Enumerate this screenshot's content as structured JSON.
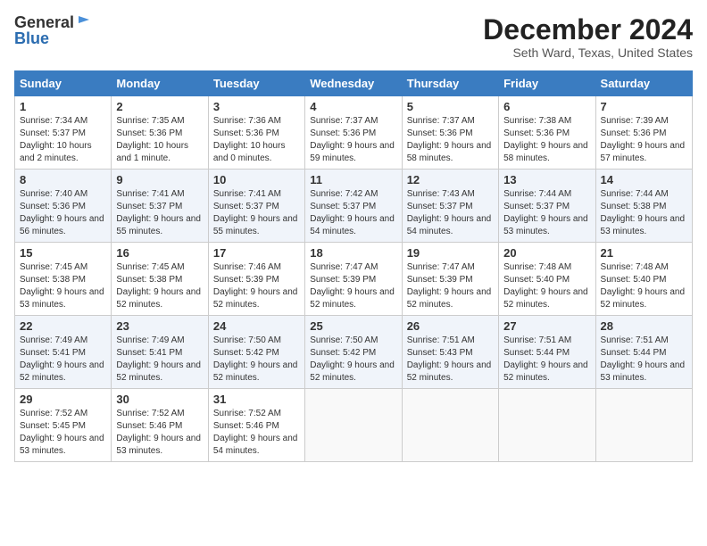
{
  "header": {
    "logo_general": "General",
    "logo_blue": "Blue",
    "month_title": "December 2024",
    "location": "Seth Ward, Texas, United States"
  },
  "days_of_week": [
    "Sunday",
    "Monday",
    "Tuesday",
    "Wednesday",
    "Thursday",
    "Friday",
    "Saturday"
  ],
  "weeks": [
    [
      {
        "day": "1",
        "sunrise": "Sunrise: 7:34 AM",
        "sunset": "Sunset: 5:37 PM",
        "daylight": "Daylight: 10 hours and 2 minutes."
      },
      {
        "day": "2",
        "sunrise": "Sunrise: 7:35 AM",
        "sunset": "Sunset: 5:36 PM",
        "daylight": "Daylight: 10 hours and 1 minute."
      },
      {
        "day": "3",
        "sunrise": "Sunrise: 7:36 AM",
        "sunset": "Sunset: 5:36 PM",
        "daylight": "Daylight: 10 hours and 0 minutes."
      },
      {
        "day": "4",
        "sunrise": "Sunrise: 7:37 AM",
        "sunset": "Sunset: 5:36 PM",
        "daylight": "Daylight: 9 hours and 59 minutes."
      },
      {
        "day": "5",
        "sunrise": "Sunrise: 7:37 AM",
        "sunset": "Sunset: 5:36 PM",
        "daylight": "Daylight: 9 hours and 58 minutes."
      },
      {
        "day": "6",
        "sunrise": "Sunrise: 7:38 AM",
        "sunset": "Sunset: 5:36 PM",
        "daylight": "Daylight: 9 hours and 58 minutes."
      },
      {
        "day": "7",
        "sunrise": "Sunrise: 7:39 AM",
        "sunset": "Sunset: 5:36 PM",
        "daylight": "Daylight: 9 hours and 57 minutes."
      }
    ],
    [
      {
        "day": "8",
        "sunrise": "Sunrise: 7:40 AM",
        "sunset": "Sunset: 5:36 PM",
        "daylight": "Daylight: 9 hours and 56 minutes."
      },
      {
        "day": "9",
        "sunrise": "Sunrise: 7:41 AM",
        "sunset": "Sunset: 5:37 PM",
        "daylight": "Daylight: 9 hours and 55 minutes."
      },
      {
        "day": "10",
        "sunrise": "Sunrise: 7:41 AM",
        "sunset": "Sunset: 5:37 PM",
        "daylight": "Daylight: 9 hours and 55 minutes."
      },
      {
        "day": "11",
        "sunrise": "Sunrise: 7:42 AM",
        "sunset": "Sunset: 5:37 PM",
        "daylight": "Daylight: 9 hours and 54 minutes."
      },
      {
        "day": "12",
        "sunrise": "Sunrise: 7:43 AM",
        "sunset": "Sunset: 5:37 PM",
        "daylight": "Daylight: 9 hours and 54 minutes."
      },
      {
        "day": "13",
        "sunrise": "Sunrise: 7:44 AM",
        "sunset": "Sunset: 5:37 PM",
        "daylight": "Daylight: 9 hours and 53 minutes."
      },
      {
        "day": "14",
        "sunrise": "Sunrise: 7:44 AM",
        "sunset": "Sunset: 5:38 PM",
        "daylight": "Daylight: 9 hours and 53 minutes."
      }
    ],
    [
      {
        "day": "15",
        "sunrise": "Sunrise: 7:45 AM",
        "sunset": "Sunset: 5:38 PM",
        "daylight": "Daylight: 9 hours and 53 minutes."
      },
      {
        "day": "16",
        "sunrise": "Sunrise: 7:45 AM",
        "sunset": "Sunset: 5:38 PM",
        "daylight": "Daylight: 9 hours and 52 minutes."
      },
      {
        "day": "17",
        "sunrise": "Sunrise: 7:46 AM",
        "sunset": "Sunset: 5:39 PM",
        "daylight": "Daylight: 9 hours and 52 minutes."
      },
      {
        "day": "18",
        "sunrise": "Sunrise: 7:47 AM",
        "sunset": "Sunset: 5:39 PM",
        "daylight": "Daylight: 9 hours and 52 minutes."
      },
      {
        "day": "19",
        "sunrise": "Sunrise: 7:47 AM",
        "sunset": "Sunset: 5:39 PM",
        "daylight": "Daylight: 9 hours and 52 minutes."
      },
      {
        "day": "20",
        "sunrise": "Sunrise: 7:48 AM",
        "sunset": "Sunset: 5:40 PM",
        "daylight": "Daylight: 9 hours and 52 minutes."
      },
      {
        "day": "21",
        "sunrise": "Sunrise: 7:48 AM",
        "sunset": "Sunset: 5:40 PM",
        "daylight": "Daylight: 9 hours and 52 minutes."
      }
    ],
    [
      {
        "day": "22",
        "sunrise": "Sunrise: 7:49 AM",
        "sunset": "Sunset: 5:41 PM",
        "daylight": "Daylight: 9 hours and 52 minutes."
      },
      {
        "day": "23",
        "sunrise": "Sunrise: 7:49 AM",
        "sunset": "Sunset: 5:41 PM",
        "daylight": "Daylight: 9 hours and 52 minutes."
      },
      {
        "day": "24",
        "sunrise": "Sunrise: 7:50 AM",
        "sunset": "Sunset: 5:42 PM",
        "daylight": "Daylight: 9 hours and 52 minutes."
      },
      {
        "day": "25",
        "sunrise": "Sunrise: 7:50 AM",
        "sunset": "Sunset: 5:42 PM",
        "daylight": "Daylight: 9 hours and 52 minutes."
      },
      {
        "day": "26",
        "sunrise": "Sunrise: 7:51 AM",
        "sunset": "Sunset: 5:43 PM",
        "daylight": "Daylight: 9 hours and 52 minutes."
      },
      {
        "day": "27",
        "sunrise": "Sunrise: 7:51 AM",
        "sunset": "Sunset: 5:44 PM",
        "daylight": "Daylight: 9 hours and 52 minutes."
      },
      {
        "day": "28",
        "sunrise": "Sunrise: 7:51 AM",
        "sunset": "Sunset: 5:44 PM",
        "daylight": "Daylight: 9 hours and 53 minutes."
      }
    ],
    [
      {
        "day": "29",
        "sunrise": "Sunrise: 7:52 AM",
        "sunset": "Sunset: 5:45 PM",
        "daylight": "Daylight: 9 hours and 53 minutes."
      },
      {
        "day": "30",
        "sunrise": "Sunrise: 7:52 AM",
        "sunset": "Sunset: 5:46 PM",
        "daylight": "Daylight: 9 hours and 53 minutes."
      },
      {
        "day": "31",
        "sunrise": "Sunrise: 7:52 AM",
        "sunset": "Sunset: 5:46 PM",
        "daylight": "Daylight: 9 hours and 54 minutes."
      },
      null,
      null,
      null,
      null
    ]
  ]
}
